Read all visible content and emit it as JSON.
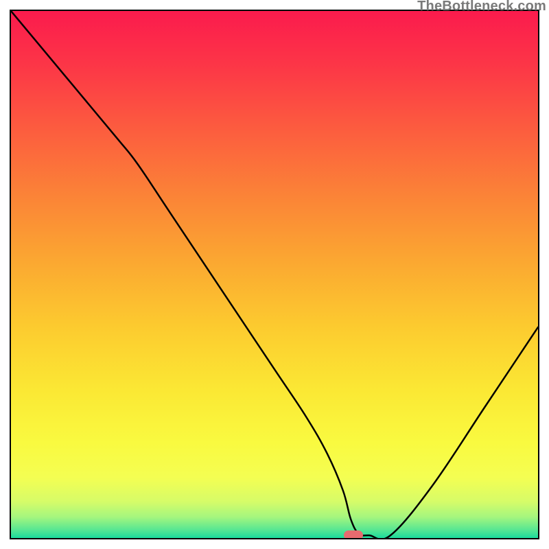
{
  "watermark": "TheBottleneck.com",
  "chart_data": {
    "type": "line",
    "title": "",
    "xlabel": "",
    "ylabel": "",
    "xlim": [
      0,
      100
    ],
    "ylim": [
      0,
      100
    ],
    "series": [
      {
        "name": "bottleneck-curve",
        "x": [
          0,
          10,
          20,
          24,
          30,
          40,
          50,
          56,
          60,
          63,
          64.5,
          66,
          68,
          72,
          80,
          90,
          100
        ],
        "y": [
          100,
          88,
          76,
          71,
          62,
          47,
          32,
          23,
          16,
          9,
          3.5,
          0.8,
          0.5,
          0.5,
          10,
          25,
          40
        ]
      }
    ],
    "marker": {
      "x": 65,
      "y": 0.5,
      "color": "#e86b6f"
    },
    "gradient_stops": [
      {
        "offset": 0.0,
        "color": "#fb1b4d"
      },
      {
        "offset": 0.1,
        "color": "#fc3547"
      },
      {
        "offset": 0.22,
        "color": "#fc5b3f"
      },
      {
        "offset": 0.35,
        "color": "#fb8337"
      },
      {
        "offset": 0.48,
        "color": "#fba931"
      },
      {
        "offset": 0.6,
        "color": "#fccb2f"
      },
      {
        "offset": 0.72,
        "color": "#fbe834"
      },
      {
        "offset": 0.82,
        "color": "#f9fa40"
      },
      {
        "offset": 0.885,
        "color": "#f4fe52"
      },
      {
        "offset": 0.93,
        "color": "#d7fc68"
      },
      {
        "offset": 0.96,
        "color": "#a5f67e"
      },
      {
        "offset": 0.985,
        "color": "#55e693"
      },
      {
        "offset": 1.0,
        "color": "#1bdb9c"
      }
    ]
  }
}
